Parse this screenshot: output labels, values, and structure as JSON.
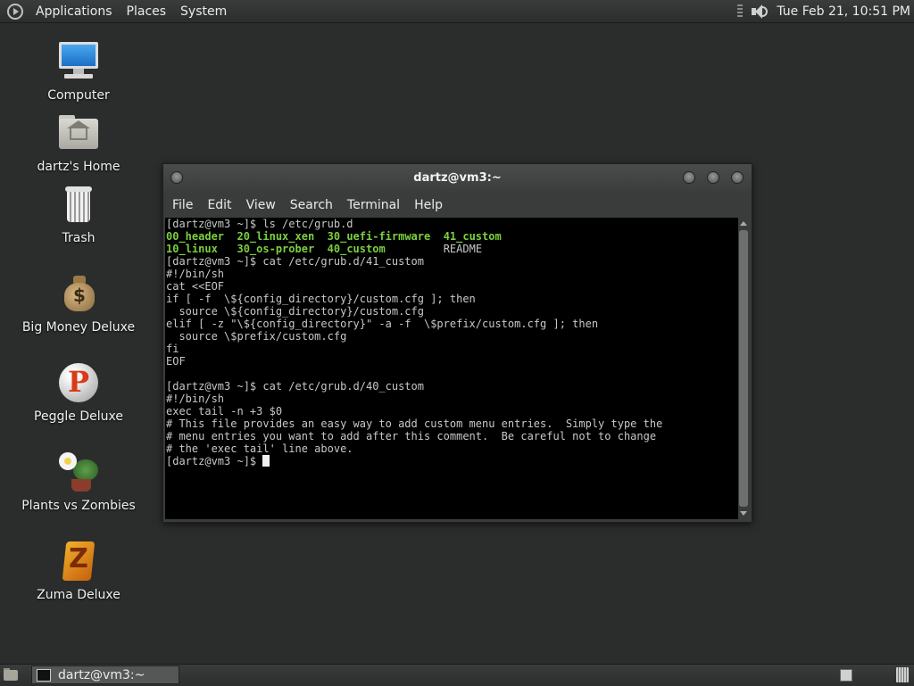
{
  "top_panel": {
    "menus": [
      "Applications",
      "Places",
      "System"
    ],
    "clock": "Tue Feb 21, 10:51 PM",
    "logo_icon": "gnome-foot-icon",
    "volume_icon": "speaker-icon"
  },
  "desktop": {
    "icons": [
      {
        "label": "Computer",
        "icon": "computer-icon"
      },
      {
        "label": "dartz's Home",
        "icon": "home-folder-icon"
      },
      {
        "label": "Trash",
        "icon": "trash-icon"
      },
      {
        "label": "Big Money Deluxe",
        "icon": "money-bag-icon"
      },
      {
        "label": "Peggle Deluxe",
        "icon": "peggle-icon"
      },
      {
        "label": "Plants vs Zombies",
        "icon": "plants-vs-zombies-icon"
      },
      {
        "label": "Zuma Deluxe",
        "icon": "zuma-icon"
      }
    ]
  },
  "terminal": {
    "title": "dartz@vm3:~",
    "menu": [
      "File",
      "Edit",
      "View",
      "Search",
      "Terminal",
      "Help"
    ],
    "lines": [
      "[dartz@vm3 ~]$ ls /etc/grub.d",
      "",
      "",
      "[dartz@vm3 ~]$ cat /etc/grub.d/41_custom",
      "#!/bin/sh",
      "cat <<EOF",
      "if [ -f  \\${config_directory}/custom.cfg ]; then",
      "  source \\${config_directory}/custom.cfg",
      "elif [ -z \"\\${config_directory}\" -a -f  \\$prefix/custom.cfg ]; then",
      "  source \\$prefix/custom.cfg",
      "fi",
      "EOF",
      "",
      "[dartz@vm3 ~]$ cat /etc/grub.d/40_custom",
      "#!/bin/sh",
      "exec tail -n +3 $0",
      "# This file provides an easy way to add custom menu entries.  Simply type the",
      "# menu entries you want to add after this comment.  Be careful not to change",
      "# the 'exec tail' line above.",
      "[dartz@vm3 ~]$ "
    ],
    "ls_output": {
      "row1": [
        "00_header",
        "20_linux_xen",
        "30_uefi-firmware",
        "41_custom"
      ],
      "row2": [
        "10_linux",
        "30_os-prober",
        "40_custom",
        "README"
      ]
    }
  },
  "bottom_panel": {
    "task_label": "dartz@vm3:~"
  },
  "colors": {
    "desktop_bg": "#2b2d2c",
    "executable_green": "#7ccf40",
    "terminal_bg": "#000000"
  }
}
